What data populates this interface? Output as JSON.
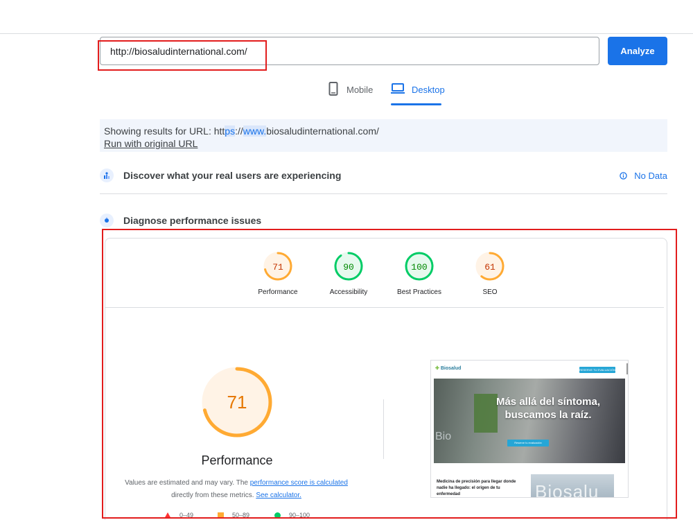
{
  "search": {
    "url_value": "http://biosaludinternational.com/",
    "analyze_label": "Analyze"
  },
  "tabs": [
    {
      "label": "Mobile",
      "icon": "mobile-icon",
      "active": false
    },
    {
      "label": "Desktop",
      "icon": "desktop-icon",
      "active": true
    }
  ],
  "notice": {
    "prefix": "Showing results for URL: htt",
    "hl1": "ps",
    "mid": "://",
    "hl2": "www.",
    "suffix": "biosaludinternational.com/",
    "link": "Run with original URL"
  },
  "sections": {
    "real_users": {
      "title": "Discover what your real users are experiencing",
      "status": "No Data",
      "icon": "crux-icon",
      "status_icon": "info-icon"
    },
    "diagnose": {
      "title": "Diagnose performance issues",
      "icon": "lighthouse-icon"
    }
  },
  "scores": [
    {
      "label": "Performance",
      "value": "71",
      "color": "#fa3",
      "text_color": "#c33300"
    },
    {
      "label": "Accessibility",
      "value": "90",
      "color": "#0c6",
      "text_color": "#008800"
    },
    {
      "label": "Best Practices",
      "value": "100",
      "color": "#0c6",
      "text_color": "#008800"
    },
    {
      "label": "SEO",
      "value": "61",
      "color": "#fa3",
      "text_color": "#c33300"
    }
  ],
  "performance": {
    "score": "71",
    "label": "Performance",
    "desc_1": "Values are estimated and may vary. The ",
    "desc_link1": "performance score is calculated",
    "desc_2": "directly from these metrics. ",
    "desc_link2": "See calculator."
  },
  "legend": [
    {
      "range": "0–49",
      "shape": "triangle",
      "color": "#f33"
    },
    {
      "range": "50–89",
      "shape": "square",
      "color": "#fa3"
    },
    {
      "range": "90–100",
      "shape": "circle",
      "color": "#0c6"
    }
  ],
  "screenshot": {
    "logo": "Biosalud",
    "header_button": "RESERVE TU EVALUACIÓN",
    "headline_1": "Más allá del síntoma,",
    "headline_2": "buscamos la raíz.",
    "cta": "Reserve tu evaluación",
    "bi_text": "Bio",
    "para": "Medicina de precisión para llegar donde nadie ha llegado: el origen de tu enfermedad",
    "img_text": "Biosalu"
  }
}
